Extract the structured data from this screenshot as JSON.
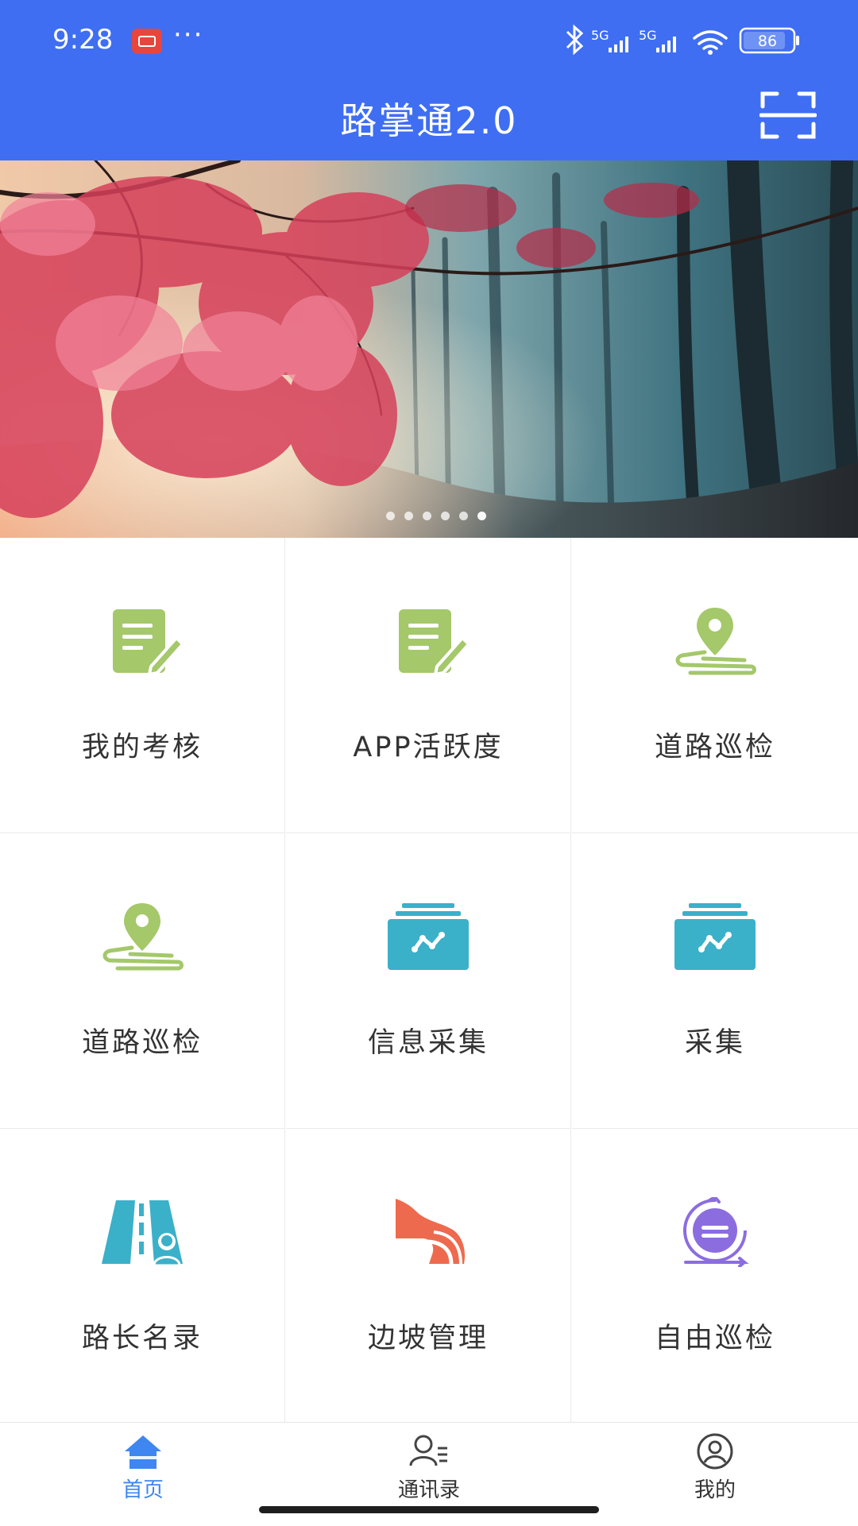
{
  "status_bar": {
    "time": "9:28",
    "more": "···",
    "network_1": "5G",
    "network_2": "5G",
    "battery": "86"
  },
  "header": {
    "title": "路掌通2.0",
    "scan_icon": "scan-icon"
  },
  "banner": {
    "image": "forest-autumn-banner",
    "slide_count": 6,
    "active_slide": 6
  },
  "grid": {
    "items": [
      {
        "label": "我的考核",
        "icon": "document-edit-icon"
      },
      {
        "label": "APP活跃度",
        "icon": "document-edit-icon"
      },
      {
        "label": "道路巡检",
        "icon": "map-pin-route-icon"
      },
      {
        "label": "道路巡检",
        "icon": "map-pin-route-icon"
      },
      {
        "label": "信息采集",
        "icon": "data-folder-icon"
      },
      {
        "label": "采集",
        "icon": "data-folder-icon"
      },
      {
        "label": "路长名录",
        "icon": "road-person-icon"
      },
      {
        "label": "边坡管理",
        "icon": "slope-icon"
      },
      {
        "label": "自由巡检",
        "icon": "free-patrol-icon"
      }
    ]
  },
  "bottom_nav": {
    "items": [
      {
        "label": "首页",
        "icon": "home-icon",
        "active": true
      },
      {
        "label": "通讯录",
        "icon": "contacts-icon",
        "active": false
      },
      {
        "label": "我的",
        "icon": "user-circle-icon",
        "active": false
      }
    ]
  },
  "colors": {
    "header": "#3f6ef2",
    "green_icon": "#a4c86a",
    "teal_icon": "#3bb0c9",
    "orange_icon": "#ee6a4e",
    "purple_icon": "#8b6de0",
    "nav_active": "#3e86f0"
  }
}
